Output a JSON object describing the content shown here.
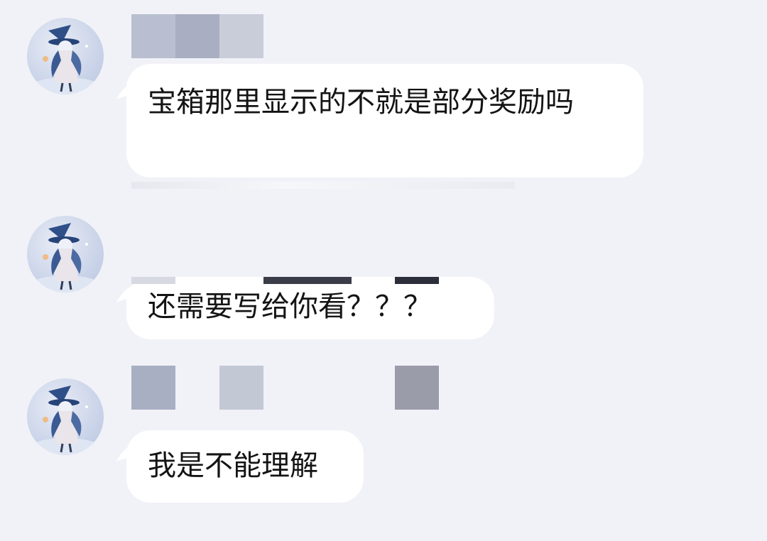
{
  "messages": [
    {
      "text": "宝箱那里显示的不就是部分奖励吗"
    },
    {
      "text": "还需要写给你看？？？"
    },
    {
      "text": "我是不能理解"
    }
  ],
  "avatar": {
    "icon": "witch-character-avatar"
  },
  "colors": {
    "background": "#f1f2f7",
    "bubble": "#ffffff",
    "text": "#141414",
    "redaction_light": "#c7ccd9",
    "redaction_mid": "#a9b0c4",
    "redaction_dark": "#9b9ca9"
  }
}
